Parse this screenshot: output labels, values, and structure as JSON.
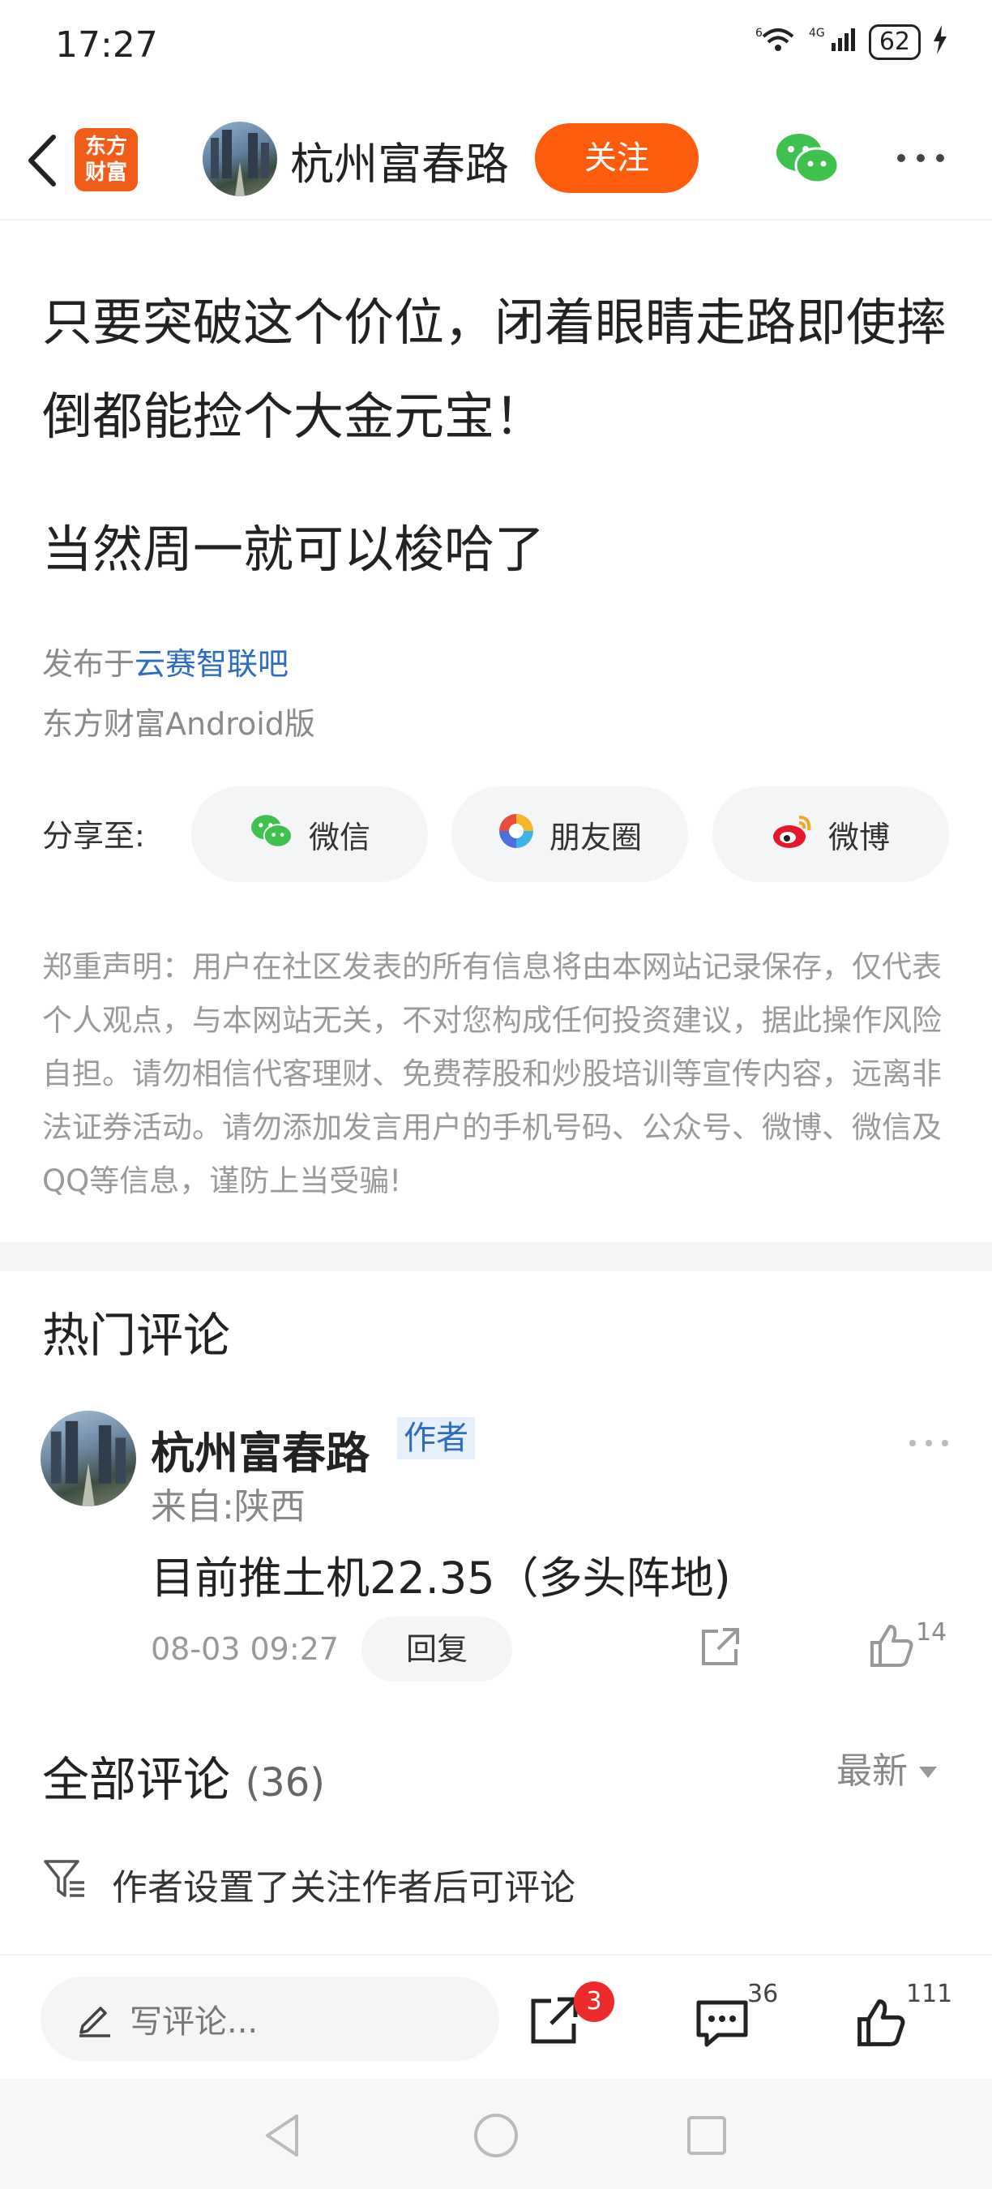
{
  "status_bar": {
    "time": "17:27",
    "net_left": "6",
    "net_right": "4G",
    "battery": "62"
  },
  "header": {
    "logo_text_line1": "东方",
    "logo_text_line2": "财富",
    "author_name": "杭州富春路",
    "follow_label": "关注"
  },
  "post": {
    "title": "只要突破这个价位，闭着眼睛走路即使摔倒都能捡个大金元宝！",
    "subtitle": "当然周一就可以梭哈了",
    "publish_prefix": "发布于",
    "publish_forum": "云赛智联吧",
    "client": "东方财富Android版"
  },
  "share": {
    "label": "分享至:",
    "wechat": "微信",
    "moments": "朋友圈",
    "weibo": "微博"
  },
  "disclaimer": "郑重声明：用户在社区发表的所有信息将由本网站记录保存，仅代表个人观点，与本网站无关，不对您构成任何投资建议，据此操作风险自担。请勿相信代客理财、免费荐股和炒股培训等宣传内容，远离非法证券活动。请勿添加发言用户的手机号码、公众号、微博、微信及QQ等信息，谨防上当受骗!",
  "hot_comments": {
    "title": "热门评论",
    "items": [
      {
        "name": "杭州富春路",
        "badge": "作者",
        "from": "来自:陕西",
        "text": "目前推土机22.35（多头阵地)",
        "time": "08-03 09:27",
        "reply_label": "回复",
        "likes": "14"
      }
    ]
  },
  "all_comments": {
    "title": "全部评论",
    "count": "(36)",
    "sort_label": "最新",
    "notice": "作者设置了关注作者后可评论"
  },
  "bottom_bar": {
    "write_placeholder": "写评论...",
    "share_badge": "3",
    "comment_count": "36",
    "like_count": "111"
  },
  "colors": {
    "accent": "#fd5c0c",
    "link": "#2d6cc0",
    "badge_red": "#ee2b2b"
  }
}
